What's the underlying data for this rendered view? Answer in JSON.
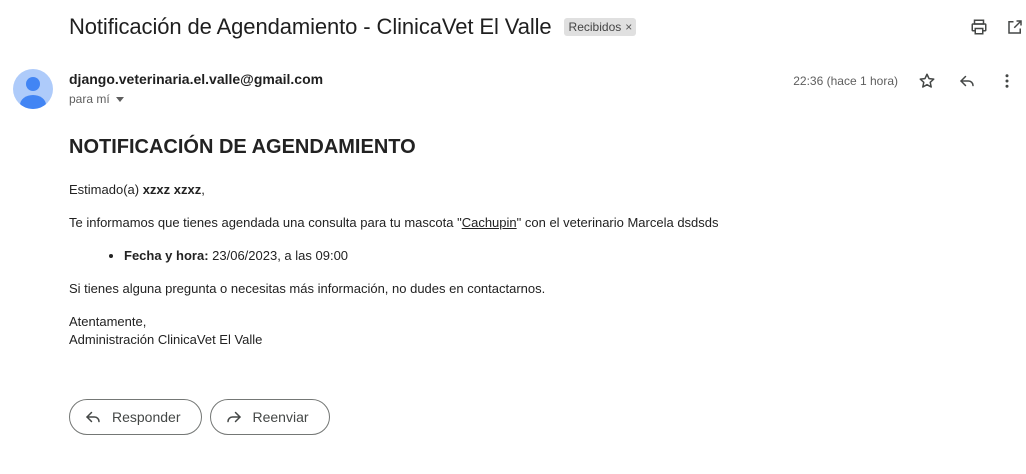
{
  "email": {
    "subject": "Notificación de Agendamiento - ClinicaVet El Valle",
    "label": "Recibidos",
    "label_remove": "×",
    "sender": "django.veterinaria.el.valle@gmail.com",
    "to_line": "para mí",
    "time": "22:36 (hace 1 hora)"
  },
  "icons": {
    "print": "print-icon",
    "open_new": "open-in-new-window-icon",
    "star": "star-icon",
    "reply": "reply-icon",
    "more": "more-vert-icon",
    "avatar": "default-avatar-icon",
    "forward": "forward-icon"
  },
  "content": {
    "heading": "NOTIFICACIÓN DE AGENDAMIENTO",
    "greeting_prefix": "Estimado(a) ",
    "greeting_name": "xzxz xzxz",
    "greeting_suffix": ",",
    "intro_prefix": "Te informamos que tienes agendada una consulta para tu mascota \"",
    "pet_name": "Cachupin",
    "intro_suffix": "\" con el veterinario Marcela dsdsds",
    "date_label": "Fecha y hora:",
    "date_value": " 23/06/2023, a las 09:00",
    "question": "Si tienes alguna pregunta o necesitas más información, no dudes en contactarnos.",
    "closing": "Atentamente,",
    "signature": "Administración ClinicaVet El Valle"
  },
  "actions": {
    "reply_label": "Responder",
    "forward_label": "Reenviar"
  },
  "colors": {
    "avatar_bg": "#aecbfa",
    "avatar_fg": "#4285f4",
    "label_bg": "#e0e0e0"
  }
}
